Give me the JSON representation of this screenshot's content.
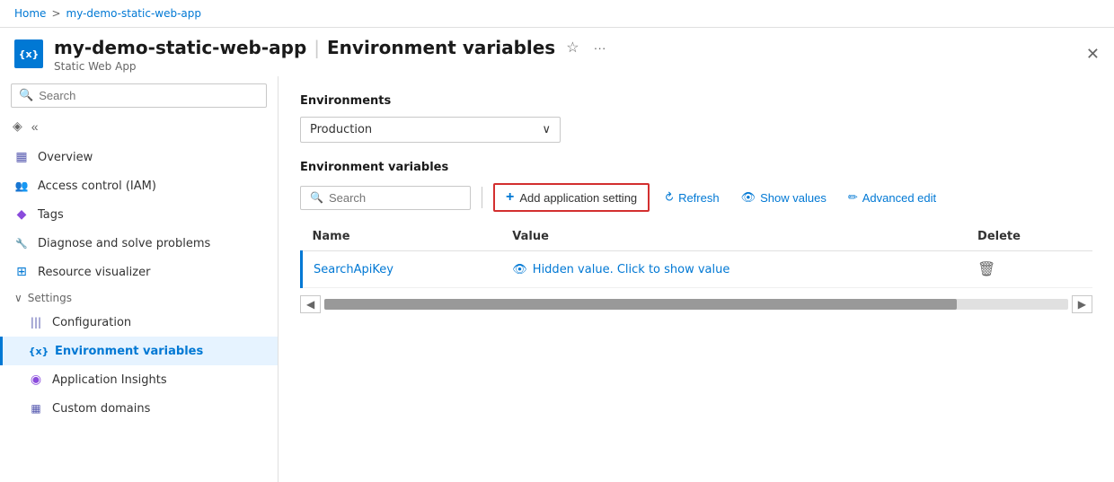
{
  "breadcrumb": {
    "home": "Home",
    "separator": ">",
    "current": "my-demo-static-web-app"
  },
  "header": {
    "app_name": "my-demo-static-web-app",
    "separator": "|",
    "page_title": "Environment variables",
    "subtitle": "Static Web App",
    "icon_label": "{x}",
    "star_icon": "☆",
    "more_icon": "···",
    "close_icon": "✕"
  },
  "sidebar": {
    "search_placeholder": "Search",
    "nav_items": [
      {
        "id": "overview",
        "label": "Overview",
        "icon": "▦",
        "indent": false
      },
      {
        "id": "iam",
        "label": "Access control (IAM)",
        "icon": "👥",
        "indent": false
      },
      {
        "id": "tags",
        "label": "Tags",
        "icon": "◆",
        "indent": false
      },
      {
        "id": "diagnose",
        "label": "Diagnose and solve problems",
        "icon": "🔧",
        "indent": false
      },
      {
        "id": "resource",
        "label": "Resource visualizer",
        "icon": "⊞",
        "indent": false
      }
    ],
    "settings_section": "Settings",
    "settings_items": [
      {
        "id": "configuration",
        "label": "Configuration",
        "icon": "|||",
        "indent": true
      },
      {
        "id": "envvars",
        "label": "Environment variables",
        "icon": "{x}",
        "indent": true,
        "active": true
      },
      {
        "id": "insights",
        "label": "Application Insights",
        "icon": "◉",
        "indent": true
      },
      {
        "id": "domains",
        "label": "Custom domains",
        "icon": "▦",
        "indent": true
      }
    ]
  },
  "content": {
    "environments_label": "Environments",
    "env_dropdown_value": "Production",
    "env_variables_label": "Environment variables",
    "toolbar": {
      "search_placeholder": "Search",
      "add_btn_label": "Add application setting",
      "refresh_label": "Refresh",
      "show_values_label": "Show values",
      "advanced_edit_label": "Advanced edit"
    },
    "table": {
      "col_name": "Name",
      "col_value": "Value",
      "col_delete": "Delete",
      "rows": [
        {
          "name": "SearchApiKey",
          "value": "Hidden value. Click to show value"
        }
      ]
    }
  }
}
